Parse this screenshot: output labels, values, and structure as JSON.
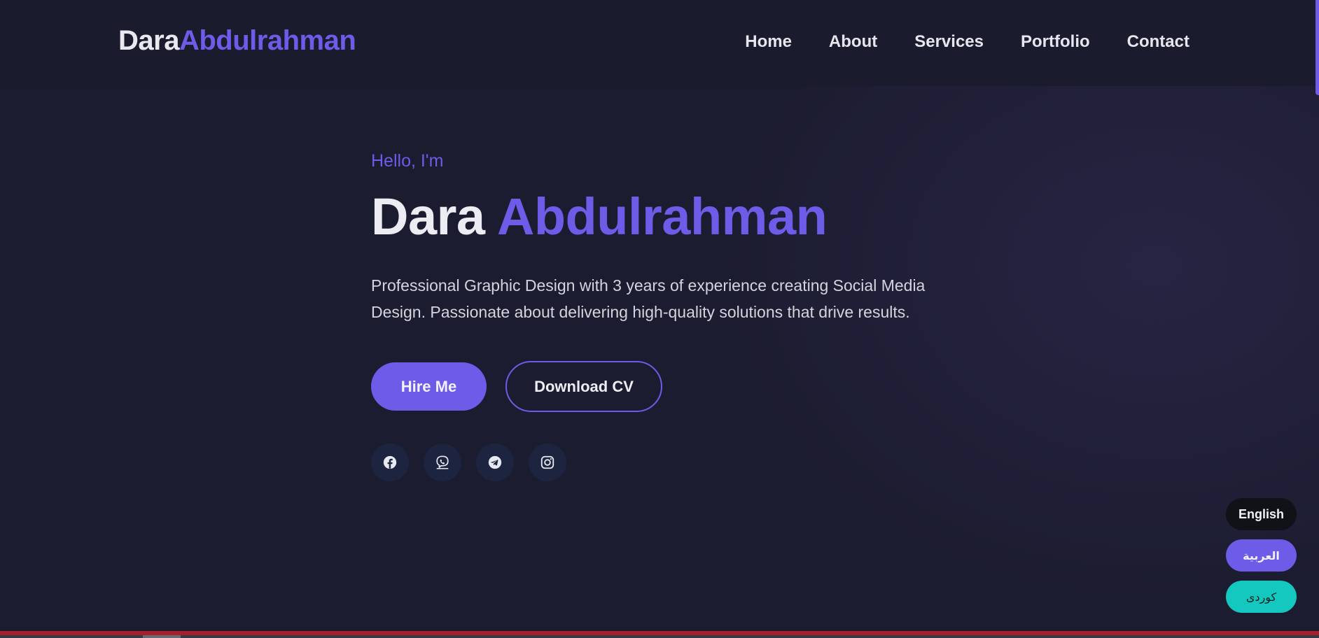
{
  "brand": {
    "first": "Dara",
    "last": "Abdulrahman"
  },
  "nav": {
    "items": [
      "Home",
      "About",
      "Services",
      "Portfolio",
      "Contact"
    ]
  },
  "hero": {
    "greeting": "Hello, I'm",
    "name_first": "Dara",
    "name_last": "Abdulrahman",
    "description": "Professional Graphic Design with 3 years of experience creating Social Media Design. Passionate about delivering high-quality solutions that drive results.",
    "primary_button": "Hire Me",
    "secondary_button": "Download CV"
  },
  "socials": [
    {
      "icon": "facebook-icon"
    },
    {
      "icon": "viber-icon"
    },
    {
      "icon": "telegram-icon"
    },
    {
      "icon": "instagram-icon"
    }
  ],
  "languages": {
    "english": "English",
    "arabic": "العربية",
    "kurdish": "كوردى"
  },
  "colors": {
    "background": "#1c1c30",
    "accent": "#6c5ce7",
    "teal": "#14c8c0",
    "bottom_bar": "#a5202e"
  }
}
